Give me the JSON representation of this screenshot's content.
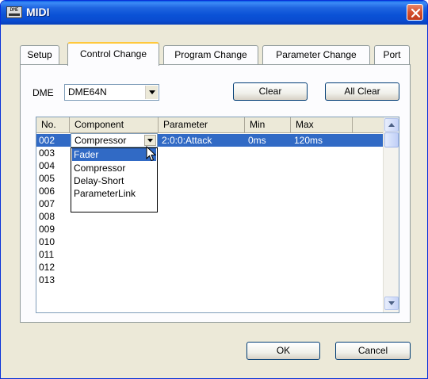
{
  "window": {
    "title": "MIDI",
    "icon_text": "DME"
  },
  "tabs": [
    {
      "label": "Setup",
      "active": false
    },
    {
      "label": "Control Change",
      "active": true
    },
    {
      "label": "Program Change",
      "active": false
    },
    {
      "label": "Parameter Change",
      "active": false
    },
    {
      "label": "Port",
      "active": false
    }
  ],
  "controls": {
    "dme_label": "DME",
    "dme_value": "DME64N",
    "clear_label": "Clear",
    "all_clear_label": "All Clear"
  },
  "list": {
    "columns": [
      "No.",
      "Component",
      "Parameter",
      "Min",
      "Max"
    ],
    "rows": [
      {
        "no": "002",
        "component": "Compressor",
        "parameter": "2:0:0:Attack",
        "min": "0ms",
        "max": "120ms"
      },
      {
        "no": "003"
      },
      {
        "no": "004"
      },
      {
        "no": "005"
      },
      {
        "no": "006"
      },
      {
        "no": "007"
      },
      {
        "no": "008"
      },
      {
        "no": "009"
      },
      {
        "no": "010"
      },
      {
        "no": "011"
      },
      {
        "no": "012"
      },
      {
        "no": "013"
      }
    ]
  },
  "dropdown": {
    "selected": "Compressor",
    "options": [
      "Fader",
      "Compressor",
      "Delay-Short",
      "ParameterLink"
    ],
    "highlighted": "Fader"
  },
  "footer": {
    "ok_label": "OK",
    "cancel_label": "Cancel"
  },
  "colors": {
    "selection": "#316ac5",
    "titlebar": "#0a52d6",
    "tab_active_border": "#ffc83c",
    "window_bg": "#ece9d8"
  },
  "icons": {
    "app": "dme-icon",
    "close": "close-icon",
    "dropdown": "chevron-down-icon",
    "scroll_up": "scroll-up-icon",
    "scroll_down": "scroll-down-icon",
    "cursor": "mouse-pointer-icon"
  }
}
